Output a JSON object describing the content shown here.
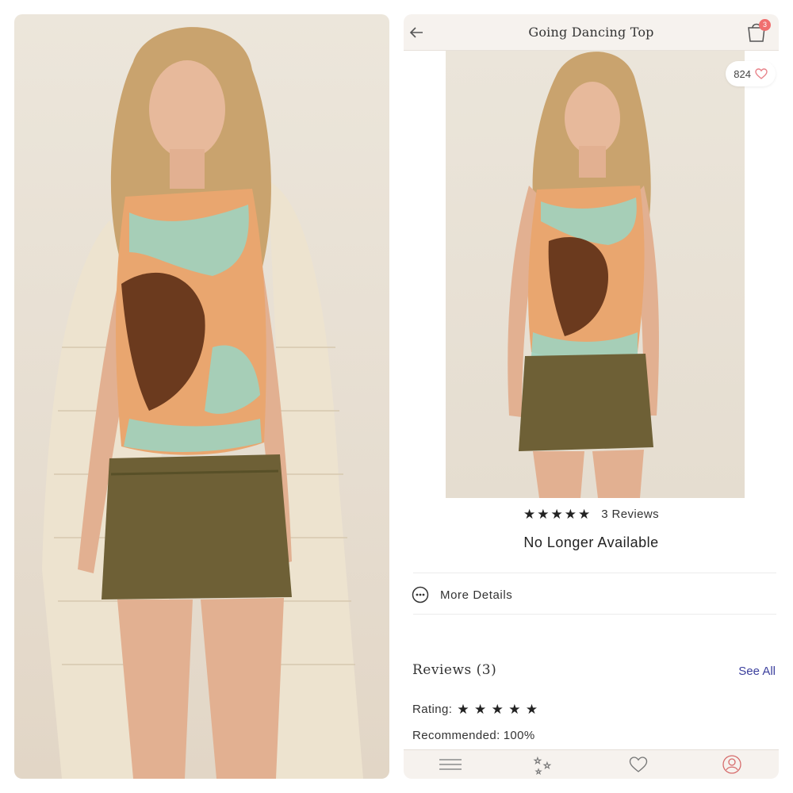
{
  "header": {
    "title": "Going Dancing Top",
    "cart_count": "3"
  },
  "product": {
    "likes": "824",
    "star_rating": 5,
    "reviews_link": "3 Reviews",
    "availability": "No Longer Available"
  },
  "details": {
    "more_details_label": "More Details"
  },
  "reviews": {
    "title": "Reviews (3)",
    "see_all": "See All",
    "rating_label": "Rating:",
    "recommended_label": "Recommended:",
    "recommended_value": "100%"
  },
  "icons": {
    "back": "arrow-left-icon",
    "cart": "shopping-bag-icon",
    "like": "heart-outline-icon",
    "more": "ellipsis-circle-icon",
    "tabs": [
      "menu-icon",
      "sparkles-icon",
      "heart-icon",
      "account-icon"
    ]
  },
  "colors": {
    "header_bg": "#f6f2ee",
    "badge": "#f06e6e",
    "link": "#3b3f9d",
    "heart": "#e8838a"
  }
}
